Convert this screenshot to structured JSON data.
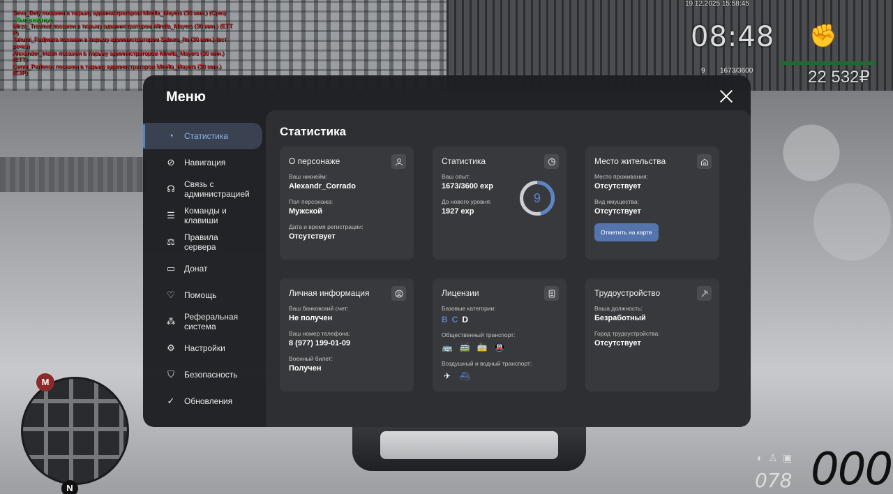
{
  "hud": {
    "chat": [
      {
        "text": "Seva_Bely посажен в тюрьму администратором Mirella_Mayers (30 мин.) (Срез)",
        "color": "red"
      },
      {
        "text": "- был разогнут.",
        "color": "green"
      },
      {
        "text": "Mirza_Travmat посажен в тюрьму администратором Mirella_Mayers (30 мин.) (ЕТТ",
        "color": "red"
      },
      {
        "text": "Р)",
        "color": "red"
      },
      {
        "text": "Takumi_Fudjwara посажен в тюрьму администратором Saburo_Ito (30 мин.) (вст",
        "color": "red"
      },
      {
        "text": "речка)",
        "color": "red"
      },
      {
        "text": "Alexander_Iriskin посажен в тюрьму администратором Mirella_Mayers (30 мин.)",
        "color": "red"
      },
      {
        "text": "(ЕТТ)",
        "color": "red"
      },
      {
        "text": "Cenni_Parfenov посажен в тюрьму администратором Mirella_Mayers (30 мин.)",
        "color": "red"
      },
      {
        "text": "(ЕЗР)",
        "color": "red"
      }
    ],
    "date": "19.12.2025 15:58:45",
    "clock": "08:48",
    "level": "9",
    "exp": "1673/3600",
    "money": "22 532₽",
    "speed": "000",
    "fuel": "078",
    "minimap_metro": "М",
    "minimap_north": "N"
  },
  "menu": {
    "title": "Меню",
    "close_icon": "close-icon",
    "sidebar": [
      {
        "label": "Статистика",
        "icon": "◔",
        "name": "statistics",
        "active": true
      },
      {
        "label": "Навигация",
        "icon": "⊘",
        "name": "navigation",
        "active": false
      },
      {
        "label": "Связь с администрацией",
        "icon": "☊",
        "name": "contact-admin",
        "active": false
      },
      {
        "label": "Команды и клавиши",
        "icon": "☰",
        "name": "commands-keys",
        "active": false
      },
      {
        "label": "Правила сервера",
        "icon": "⚖",
        "name": "server-rules",
        "active": false
      },
      {
        "label": "Донат",
        "icon": "▭",
        "name": "donate",
        "active": false
      },
      {
        "label": "Помощь",
        "icon": "♡",
        "name": "help",
        "active": false
      },
      {
        "label": "Реферальная система",
        "icon": "⁂",
        "name": "referral-system",
        "active": false
      },
      {
        "label": "Настройки",
        "icon": "⚙",
        "name": "settings",
        "active": false
      },
      {
        "label": "Безопасность",
        "icon": "⛉",
        "name": "security",
        "active": false
      },
      {
        "label": "Обновления",
        "icon": "✓",
        "name": "updates",
        "active": false
      }
    ],
    "content_title": "Статистика",
    "cards": {
      "character": {
        "title": "О персонаже",
        "icon": "user-icon",
        "fields": [
          {
            "label": "Ваш никнейм:",
            "value": "Alexandr_Corrado"
          },
          {
            "label": "Пол персонажа:",
            "value": "Мужской"
          },
          {
            "label": "Дата и время регистрации:",
            "value": "Отсутствует"
          }
        ]
      },
      "stats": {
        "title": "Статистика",
        "icon": "pie-chart-icon",
        "fields": [
          {
            "label": "Ваш опыт:",
            "value": "1673/3600 exp"
          },
          {
            "label": "До нового уровня:",
            "value": "1927 exp"
          }
        ],
        "level": "9",
        "level_progress": 0.4647
      },
      "residence": {
        "title": "Место жительства",
        "icon": "home-icon",
        "fields": [
          {
            "label": "Место проживания:",
            "value": "Отсутствует"
          },
          {
            "label": "Вид имущества:",
            "value": "Отсутствует"
          }
        ],
        "button": "Отметить на карте"
      },
      "personal": {
        "title": "Личная информация",
        "icon": "user-circle-icon",
        "fields": [
          {
            "label": "Ваш банковский счет:",
            "value": "Не получен"
          },
          {
            "label": "Ваш номер телефона:",
            "value": "8 (977) 199-01-09"
          },
          {
            "label": "Военный билет:",
            "value": "Получен"
          }
        ]
      },
      "licenses": {
        "title": "Лицензии",
        "icon": "license-icon",
        "base_label": "Базовые категории:",
        "categories": [
          {
            "letter": "B",
            "owned": true
          },
          {
            "letter": "C",
            "owned": true
          },
          {
            "letter": "D",
            "owned": false
          }
        ],
        "public_label": "Общественный транспорт:",
        "public_icons": [
          {
            "icon": "bus-icon",
            "glyph": "🚌",
            "owned": false
          },
          {
            "icon": "trolleybus-icon",
            "glyph": "🚎",
            "owned": true
          },
          {
            "icon": "tram-icon",
            "glyph": "🚋",
            "owned": true
          },
          {
            "icon": "metro-icon",
            "glyph": "🚇",
            "owned": false
          }
        ],
        "air_water_label": "Воздушный и водный транспорт:",
        "air_water_icons": [
          {
            "icon": "plane-icon",
            "glyph": "✈",
            "owned": false
          },
          {
            "icon": "boat-icon",
            "glyph": "⛴",
            "owned": true
          }
        ]
      },
      "employment": {
        "title": "Трудоустройство",
        "icon": "pickaxe-icon",
        "fields": [
          {
            "label": "Ваша должность:",
            "value": "Безработный"
          },
          {
            "label": "Город трудоустройства:",
            "value": "Отсутствует"
          }
        ]
      }
    },
    "colors": {
      "accent": "#5b84c8",
      "button": "#5474ad",
      "panel": "#1e1f22",
      "card": "#38393c"
    }
  }
}
